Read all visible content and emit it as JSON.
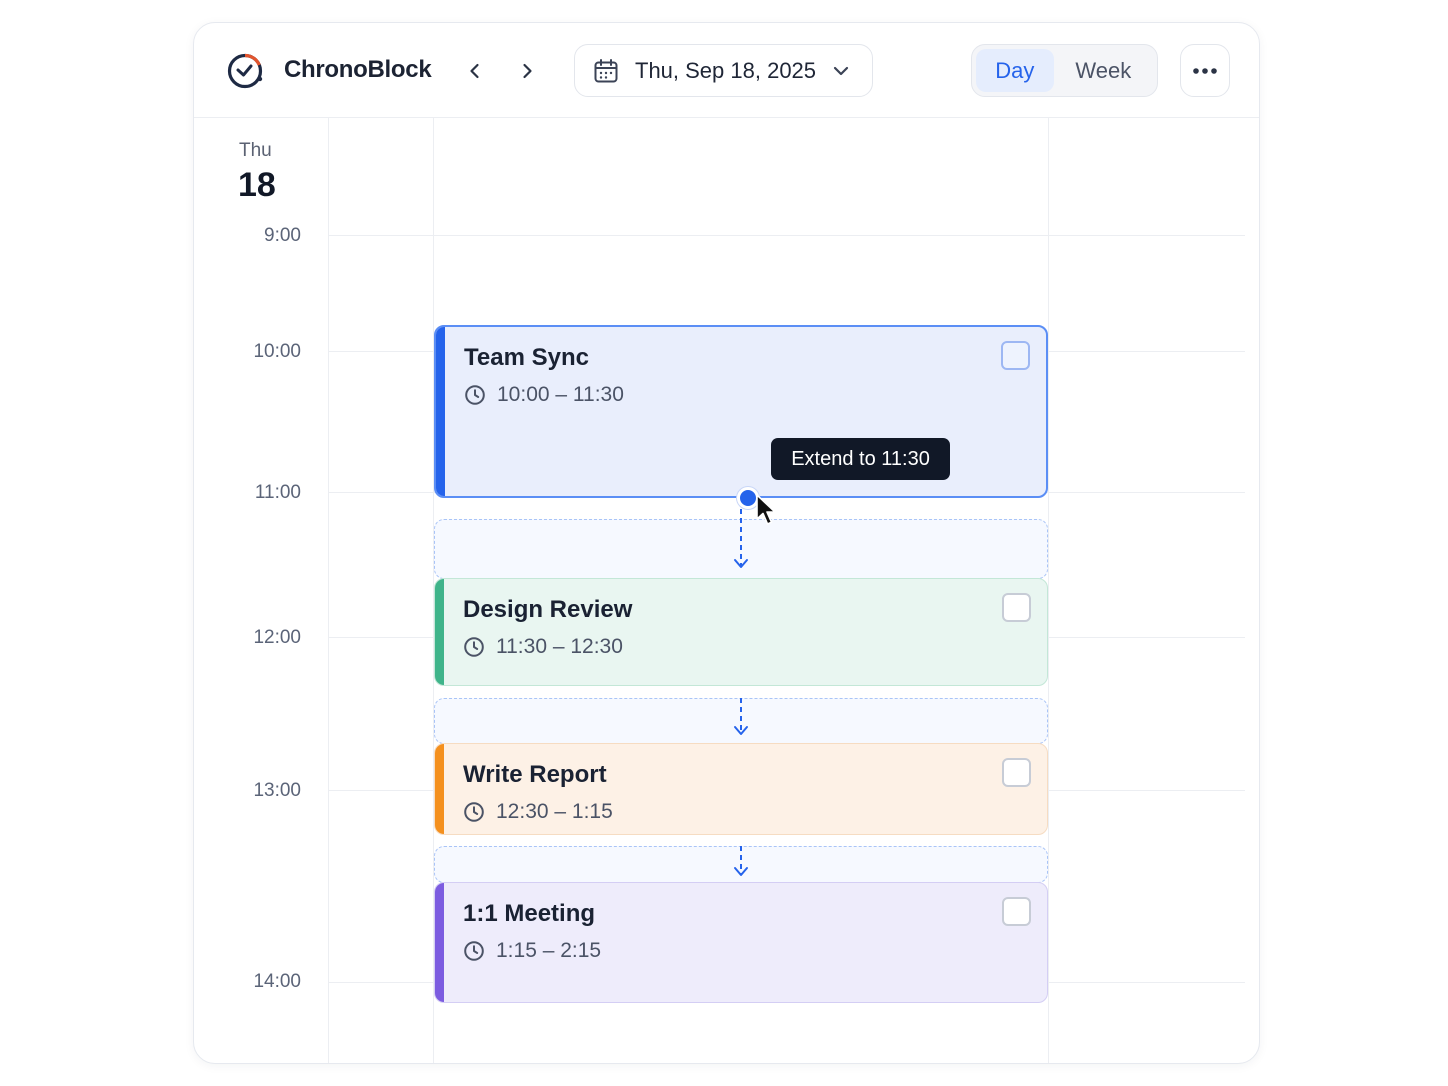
{
  "app": {
    "name": "ChronoBlock"
  },
  "header": {
    "date_label": "Thu, Sep 18, 2025",
    "views": {
      "day": "Day",
      "week": "Week"
    },
    "active_view": "Day"
  },
  "day_column": {
    "day_name": "Thu",
    "day_number": "18"
  },
  "time_labels": [
    "9:00",
    "10:00",
    "11:00",
    "12:00",
    "13:00",
    "14:00"
  ],
  "events": [
    {
      "title": "Team Sync",
      "time": "10:00 – 11:30",
      "color": "#2563eb"
    },
    {
      "title": "Design Review",
      "time": "11:30 – 12:30",
      "color": "#3fb48a"
    },
    {
      "title": "Write Report",
      "time": "12:30 – 1:15",
      "color": "#f4901e"
    },
    {
      "title": "1:1 Meeting",
      "time": "1:15 – 2:15",
      "color": "#7c5ce0"
    }
  ],
  "tooltip": {
    "text": "Extend to 11:30"
  },
  "colors": {
    "accent": "#2563eb"
  }
}
